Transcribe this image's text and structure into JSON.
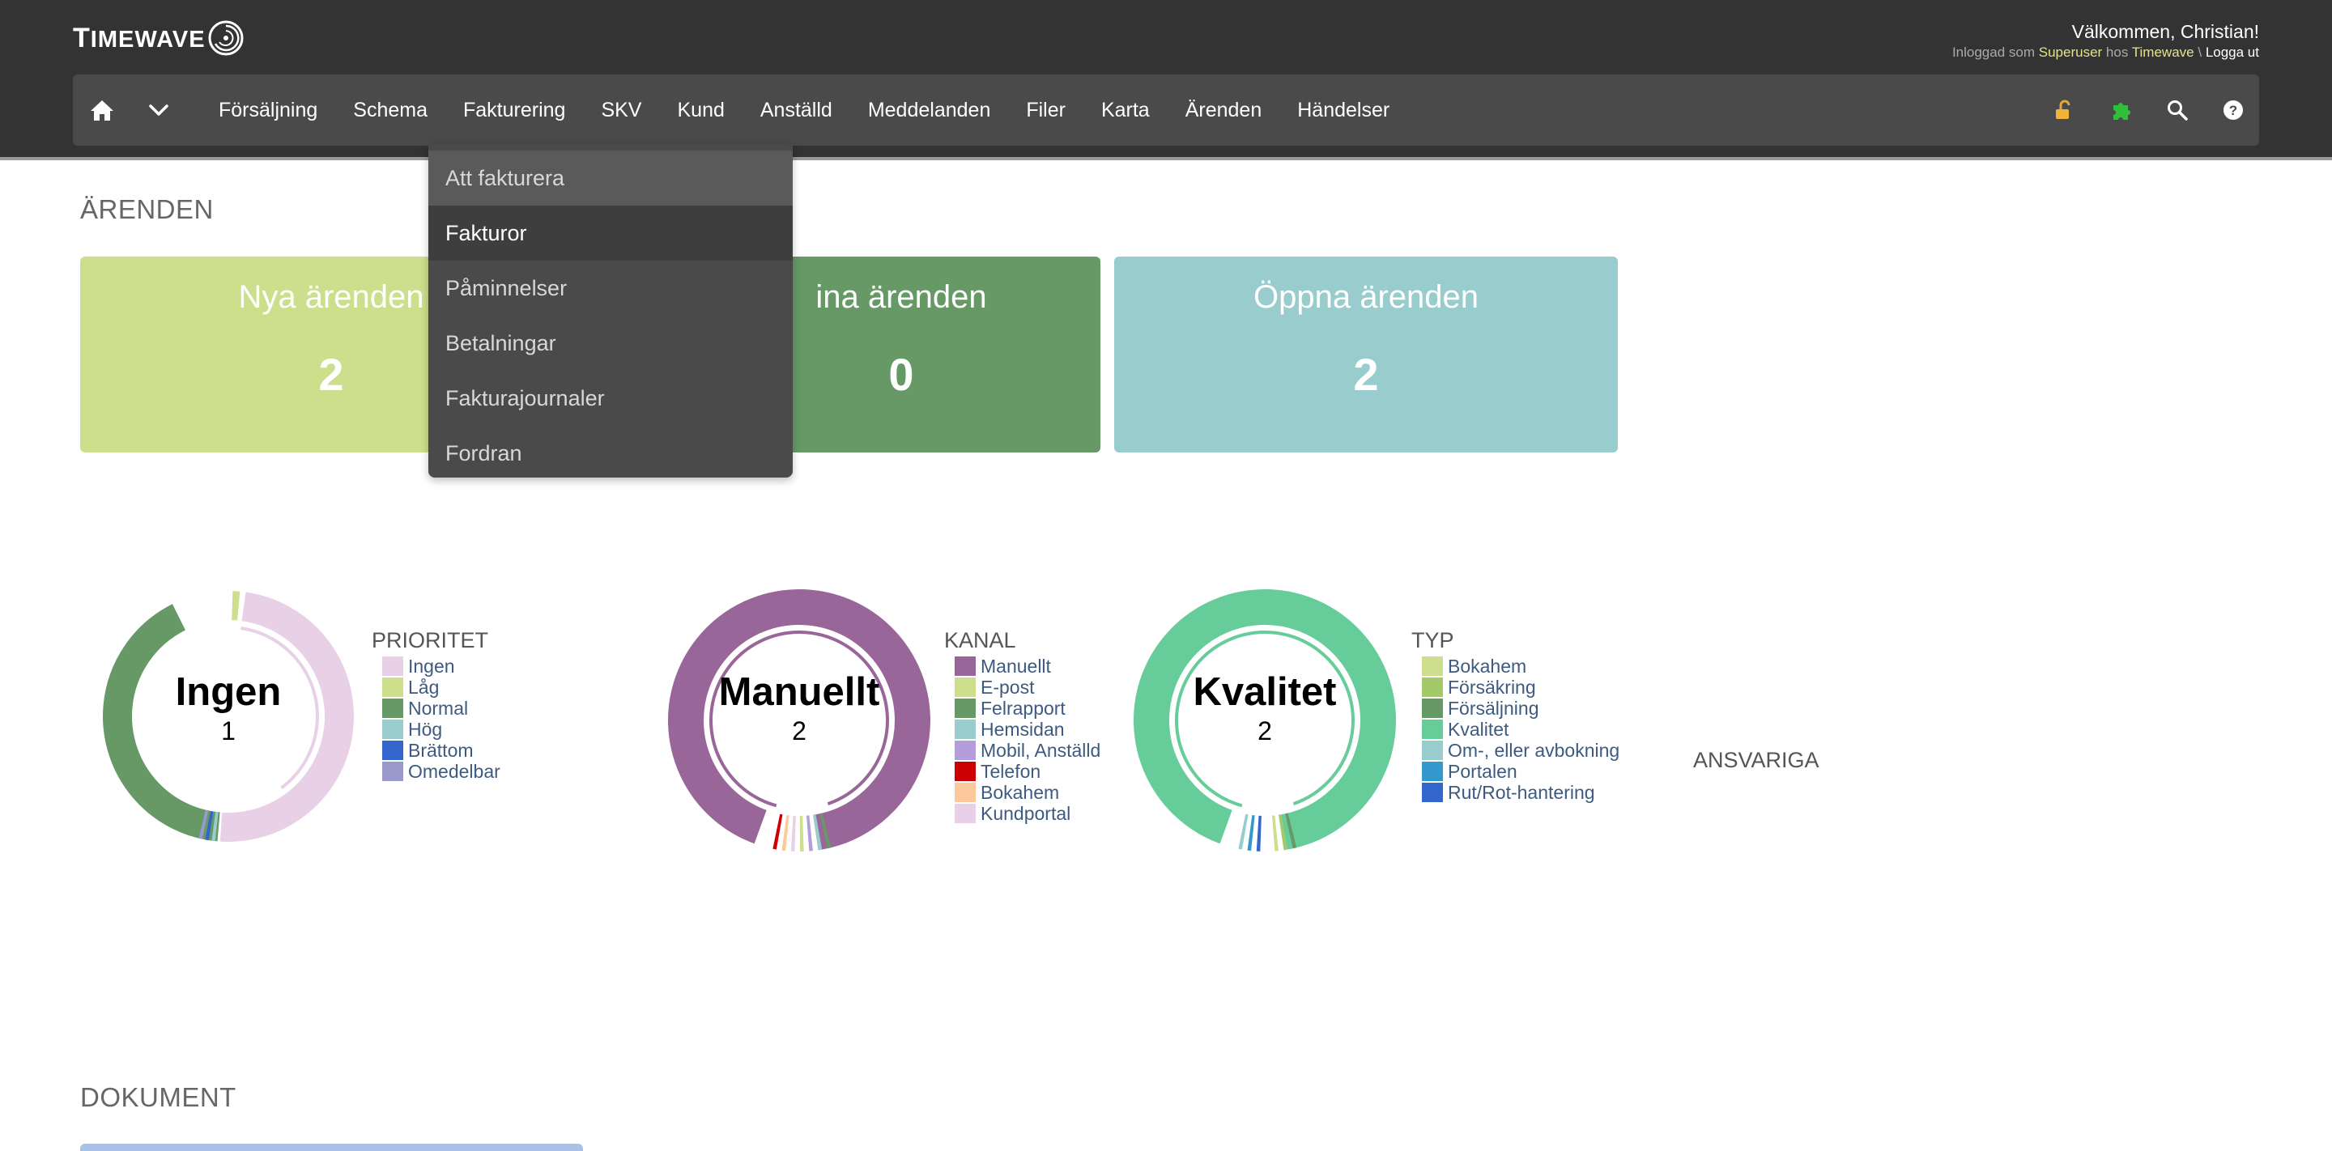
{
  "app": {
    "logo_text_first": "T",
    "logo_text_rest": "IMEWAVE",
    "welcome": "Välkommen, Christian!",
    "login_prefix": "Inloggad som",
    "login_user": "Superuser",
    "login_mid": "hos",
    "login_company": "Timewave",
    "login_sep": "\\",
    "logout": "Logga ut"
  },
  "nav": {
    "items": [
      "Försäljning",
      "Schema",
      "Fakturering",
      "SKV",
      "Kund",
      "Anställd",
      "Meddelanden",
      "Filer",
      "Karta",
      "Ärenden",
      "Händelser"
    ],
    "icons": [
      "home-icon",
      "chevron-down-icon",
      "unlock-icon",
      "puzzle-icon",
      "search-icon",
      "help-icon"
    ]
  },
  "dropdown": {
    "items": [
      "Att fakturera",
      "Fakturor",
      "Påminnelser",
      "Betalningar",
      "Fakturajournaler",
      "Fordran"
    ]
  },
  "arenden": {
    "title": "ÄRENDEN",
    "cards": [
      {
        "label": "Nya ärenden",
        "value": "2",
        "color": "#cddf8c"
      },
      {
        "label": "ina ärenden",
        "value": "0",
        "color": "#669966"
      },
      {
        "label": "Öppna ärenden",
        "value": "2",
        "color": "#99cccc"
      }
    ]
  },
  "charts": {
    "prioritet": {
      "title": "PRIORITET",
      "center_label": "Ingen",
      "center_value": "1",
      "legend": [
        {
          "label": "Ingen",
          "color": "#e8d0e6"
        },
        {
          "label": "Låg",
          "color": "#cddf8c"
        },
        {
          "label": "Normal",
          "color": "#669966"
        },
        {
          "label": "Hög",
          "color": "#99cccc"
        },
        {
          "label": "Brättom",
          "color": "#3366cc"
        },
        {
          "label": "Omedelbar",
          "color": "#9999cc"
        }
      ]
    },
    "kanal": {
      "title": "KANAL",
      "center_label": "Manuellt",
      "center_value": "2",
      "legend": [
        {
          "label": "Manuellt",
          "color": "#996699"
        },
        {
          "label": "E-post",
          "color": "#cddf8c"
        },
        {
          "label": "Felrapport",
          "color": "#669966"
        },
        {
          "label": "Hemsidan",
          "color": "#99cccc"
        },
        {
          "label": "Mobil, Anställd",
          "color": "#b39ddb"
        },
        {
          "label": "Telefon",
          "color": "#cc0000"
        },
        {
          "label": "Bokahem",
          "color": "#fcc99a"
        },
        {
          "label": "Kundportal",
          "color": "#e8d0e6"
        }
      ]
    },
    "typ": {
      "title": "TYP",
      "center_label": "Kvalitet",
      "center_value": "2",
      "legend": [
        {
          "label": "Bokahem",
          "color": "#cddf8c"
        },
        {
          "label": "Försäkring",
          "color": "#a3c96b"
        },
        {
          "label": "Försäljning",
          "color": "#669966"
        },
        {
          "label": "Kvalitet",
          "color": "#66cc99"
        },
        {
          "label": "Om-, eller avbokning",
          "color": "#99cccc"
        },
        {
          "label": "Portalen",
          "color": "#3399cc"
        },
        {
          "label": "Rut/Rot-hantering",
          "color": "#3366cc"
        }
      ]
    }
  },
  "ansvariga": "ANSVARIGA",
  "dokument": {
    "title": "DOKUMENT"
  }
}
